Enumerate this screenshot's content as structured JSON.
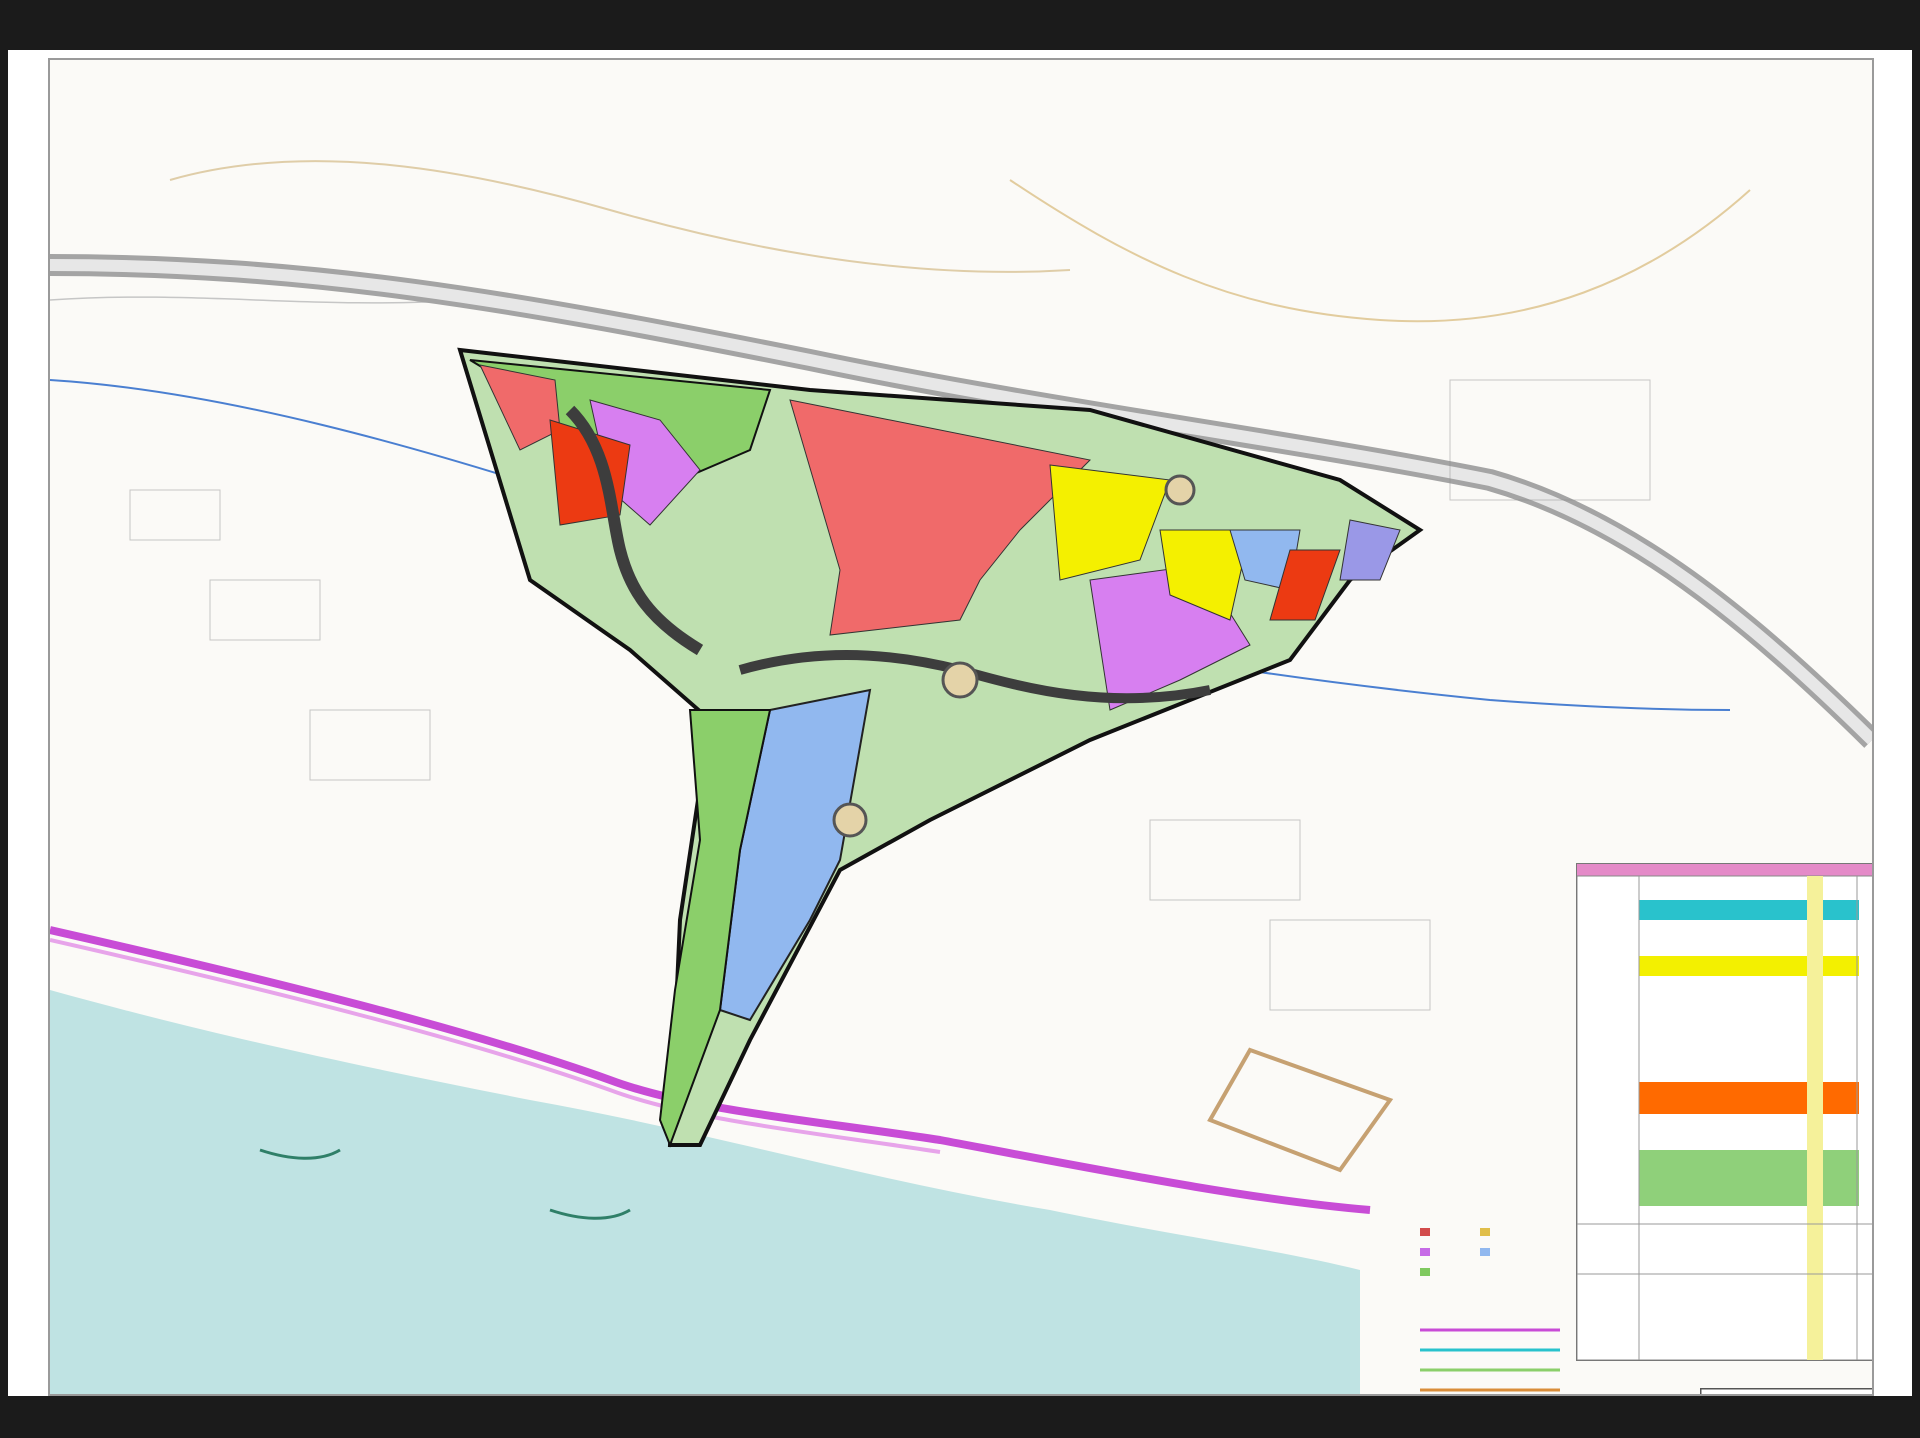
{
  "drawing": {
    "type": "urban development zoning plan",
    "colors": {
      "residential_red": "#f06a6a",
      "dense_orange_red": "#ec3a12",
      "commercial_magenta": "#d77ff0",
      "public_blue": "#91b8ef",
      "industrial_yellow": "#f4f000",
      "green_space": "#8bcf6a",
      "road_gray": "#8b8f8b",
      "sea": "#bfe3e3",
      "boundary_magenta": "#c84cd6",
      "table_cyan": "#29c2cc",
      "table_yellow": "#f3f000",
      "table_orange": "#ff6a00",
      "table_green": "#8fd07a"
    },
    "icons": [
      "north-arrow-icon",
      "scale-bar-icon",
      "company-logo-icon"
    ]
  }
}
